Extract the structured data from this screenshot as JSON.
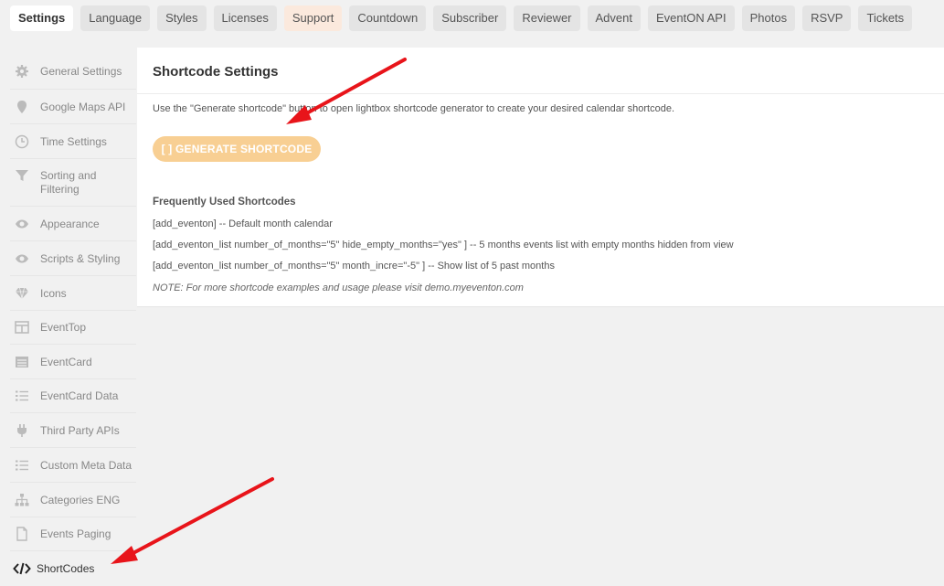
{
  "tabs": [
    {
      "label": "Settings",
      "active": true
    },
    {
      "label": "Language"
    },
    {
      "label": "Styles"
    },
    {
      "label": "Licenses"
    },
    {
      "label": "Support"
    },
    {
      "label": "Countdown"
    },
    {
      "label": "Subscriber"
    },
    {
      "label": "Reviewer"
    },
    {
      "label": "Advent"
    },
    {
      "label": "EventON API"
    },
    {
      "label": "Photos"
    },
    {
      "label": "RSVP"
    },
    {
      "label": "Tickets"
    }
  ],
  "sidebar": {
    "items": [
      {
        "label": "General Settings",
        "icon": "gear-icon"
      },
      {
        "label": "Google Maps API",
        "icon": "map-pin-icon"
      },
      {
        "label": "Time Settings",
        "icon": "clock-icon"
      },
      {
        "label": "Sorting and Filtering",
        "icon": "filter-icon"
      },
      {
        "label": "Appearance",
        "icon": "eye-icon"
      },
      {
        "label": "Scripts & Styling",
        "icon": "eye-icon"
      },
      {
        "label": "Icons",
        "icon": "diamond-icon"
      },
      {
        "label": "EventTop",
        "icon": "layout-icon"
      },
      {
        "label": "EventCard",
        "icon": "card-icon"
      },
      {
        "label": "EventCard Data",
        "icon": "list-icon"
      },
      {
        "label": "Third Party APIs",
        "icon": "plug-icon"
      },
      {
        "label": "Custom Meta Data",
        "icon": "list-icon"
      },
      {
        "label": "Categories ENG",
        "icon": "sitemap-icon"
      },
      {
        "label": "Events Paging",
        "icon": "file-icon"
      },
      {
        "label": "ShortCodes",
        "icon": "code-icon",
        "active": true
      }
    ]
  },
  "main": {
    "title": "Shortcode Settings",
    "description": "Use the \"Generate shortcode\" button to open lightbox shortcode generator to create your desired calendar shortcode.",
    "button_label": "[ ] GENERATE SHORTCODE",
    "heading": "Frequently Used Shortcodes",
    "lines": [
      "[add_eventon] -- Default month calendar",
      "[add_eventon_list number_of_months=\"5\" hide_empty_months=\"yes\" ] -- 5 months events list with empty months hidden from view",
      "[add_eventon_list number_of_months=\"5\" month_incre=\"-5\" ] -- Show list of 5 past months"
    ],
    "note": "NOTE: For more shortcode examples and usage please visit demo.myeventon.com"
  },
  "colors": {
    "button": "#f8cf93",
    "arrow": "#e8141a",
    "support_tab": "#fbe9dd"
  }
}
